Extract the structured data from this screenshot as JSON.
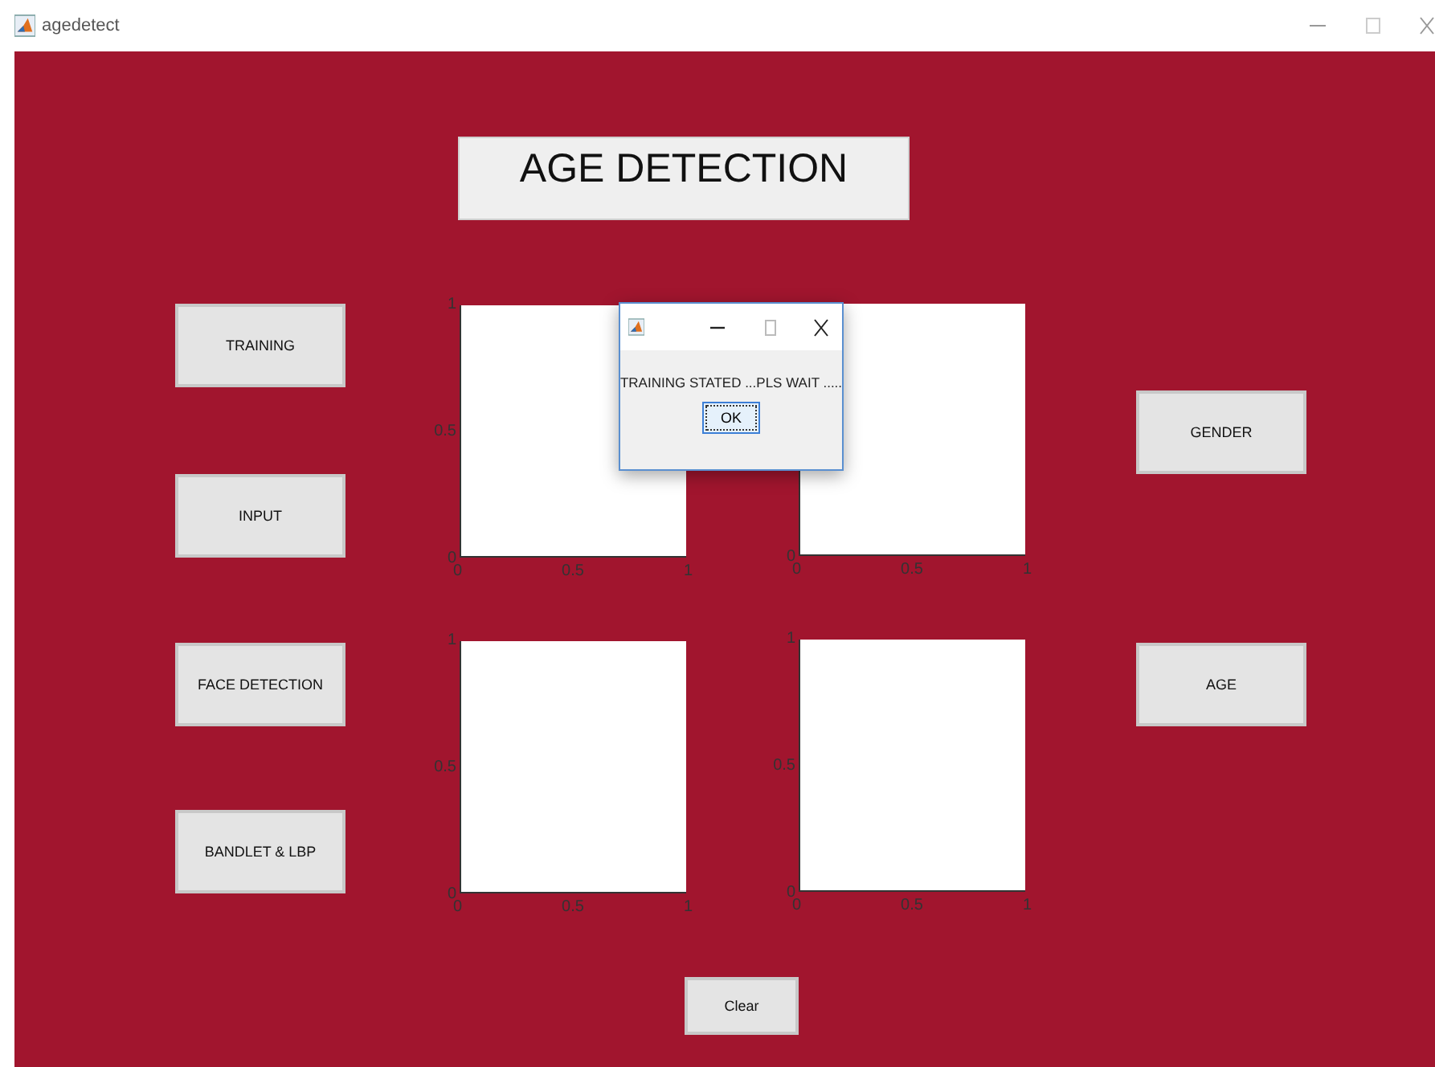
{
  "window": {
    "title": "agedetect"
  },
  "heading": "AGE DETECTION",
  "buttons": [
    {
      "label": "TRAINING"
    },
    {
      "label": "INPUT"
    },
    {
      "label": "FACE DETECTION"
    },
    {
      "label": "BANDLET & LBP"
    },
    {
      "label": "GENDER"
    },
    {
      "label": "AGE"
    },
    {
      "label": "Clear"
    }
  ],
  "axes": [
    {
      "xticks": [
        "0",
        "0.5",
        "1"
      ],
      "yticks": [
        "1",
        "0.5",
        "0"
      ]
    },
    {
      "xticks": [
        "0",
        "0.5",
        "1"
      ],
      "yticks": [
        "0"
      ]
    },
    {
      "xticks": [
        "0",
        "0.5",
        "1"
      ],
      "yticks": [
        "1",
        "0.5",
        "0"
      ]
    },
    {
      "xticks": [
        "0",
        "0.5",
        "1"
      ],
      "yticks": [
        "1",
        "0.5",
        "0"
      ]
    }
  ],
  "dialog": {
    "message": "TRAINING STATED ...PLS WAIT .....",
    "button": "OK"
  }
}
